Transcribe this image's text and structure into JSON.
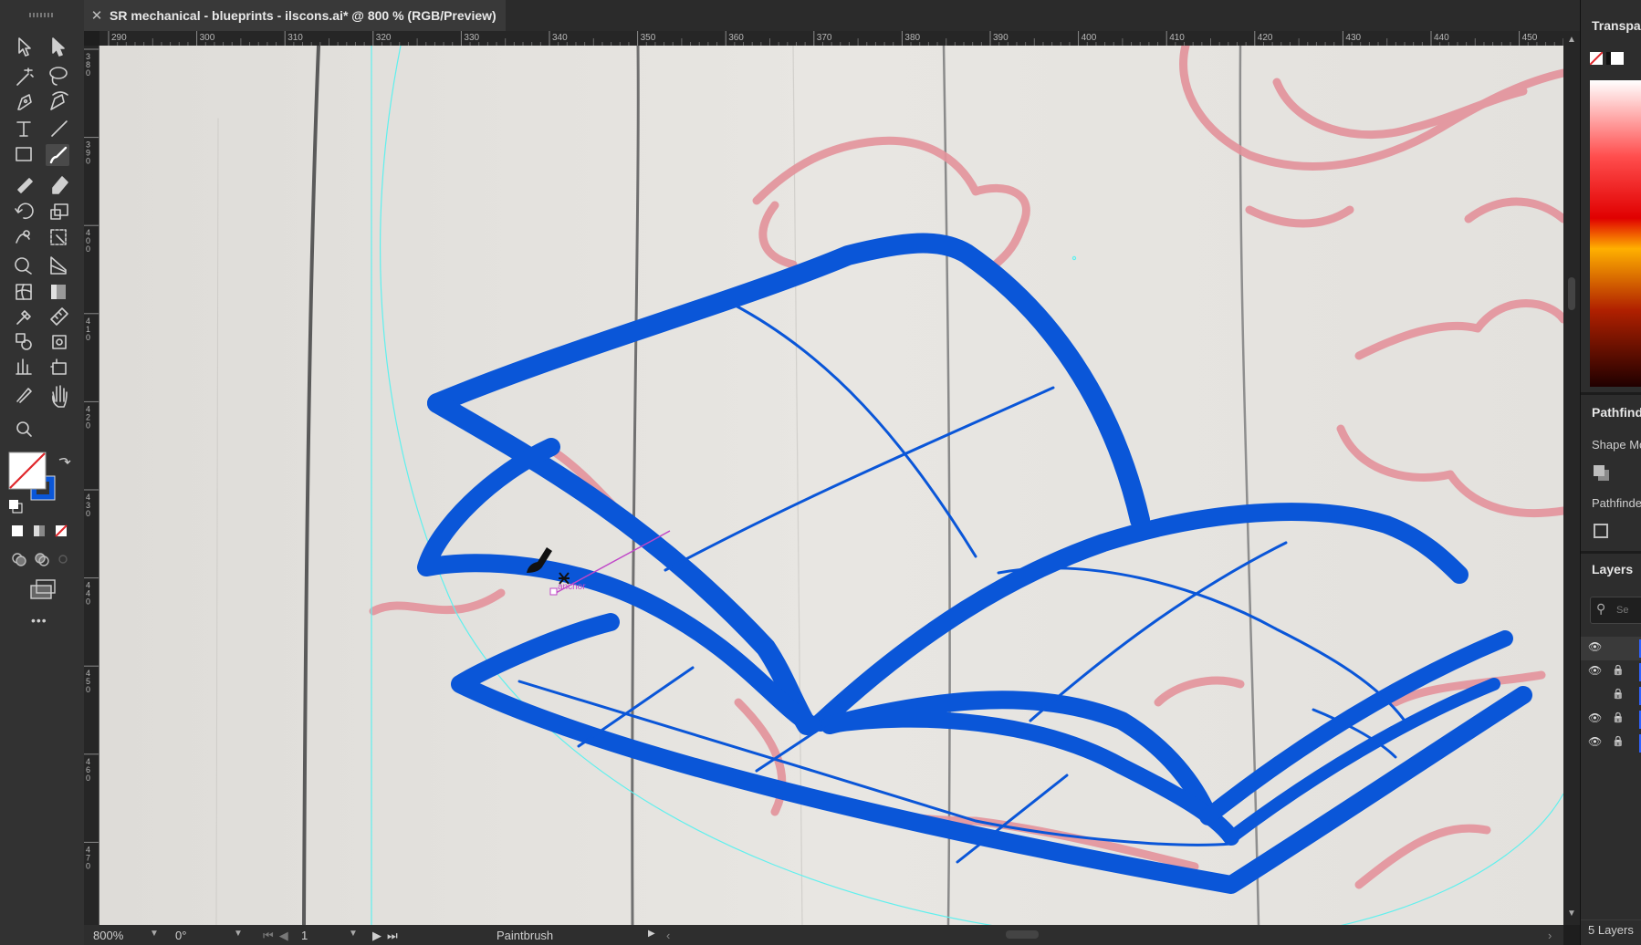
{
  "window": {
    "document_tab": "SR mechanical - blueprints - ilscons.ai* @ 800 % (RGB/Preview)",
    "close_glyph": "✕"
  },
  "rulers": {
    "horizontal_ticks": [
      "290",
      "300",
      "310",
      "320",
      "330",
      "340",
      "350",
      "360",
      "370",
      "380",
      "390",
      "400",
      "410",
      "420",
      "430",
      "440",
      "450"
    ],
    "vertical_ticks": [
      "380",
      "390",
      "400",
      "410",
      "420",
      "430",
      "440",
      "450",
      "460",
      "470"
    ]
  },
  "toolbar": {
    "tools": [
      "selection-tool",
      "direct-selection-tool",
      "magic-wand-tool",
      "lasso-tool",
      "pen-tool",
      "curvature-tool",
      "type-tool",
      "line-segment-tool",
      "rectangle-tool",
      "paintbrush-tool",
      "shaper-tool",
      "eraser-tool",
      "rotate-tool",
      "scale-tool",
      "warp-tool",
      "free-transform-tool",
      "shape-builder-tool",
      "perspective-grid-tool",
      "mesh-tool",
      "gradient-tool",
      "eyedropper-tool",
      "measure-tool",
      "blend-tool",
      "symbol-sprayer-tool",
      "column-graph-tool",
      "artboard-tool",
      "slice-tool",
      "hand-tool",
      "zoom-tool"
    ],
    "active_tool": "paintbrush-tool",
    "fill_color": "none",
    "stroke_color": "#0a56d8",
    "more_label": "•••"
  },
  "canvas": {
    "cursor_label": "anchor",
    "artwork_stroke_color": "#0a56d8",
    "sketch_color": "#e3929b",
    "guide_color": "#5ff0ee"
  },
  "statusbar": {
    "zoom": "800%",
    "rotation": "0°",
    "artboard_number": "1",
    "current_tool": "Paintbrush"
  },
  "panels": {
    "transparency_title": "Transpa",
    "pathfinder_title": "Pathfind",
    "shape_modes_label": "Shape Mo",
    "pathfinders_label": "Pathfinde",
    "layers_title": "Layers",
    "layers_search_placeholder": "Se",
    "layers_count": "5 Layers",
    "layer_rows": [
      {
        "visible": true,
        "locked": false
      },
      {
        "visible": true,
        "locked": true
      },
      {
        "visible": false,
        "locked": true
      },
      {
        "visible": true,
        "locked": true
      },
      {
        "visible": true,
        "locked": true
      }
    ]
  }
}
